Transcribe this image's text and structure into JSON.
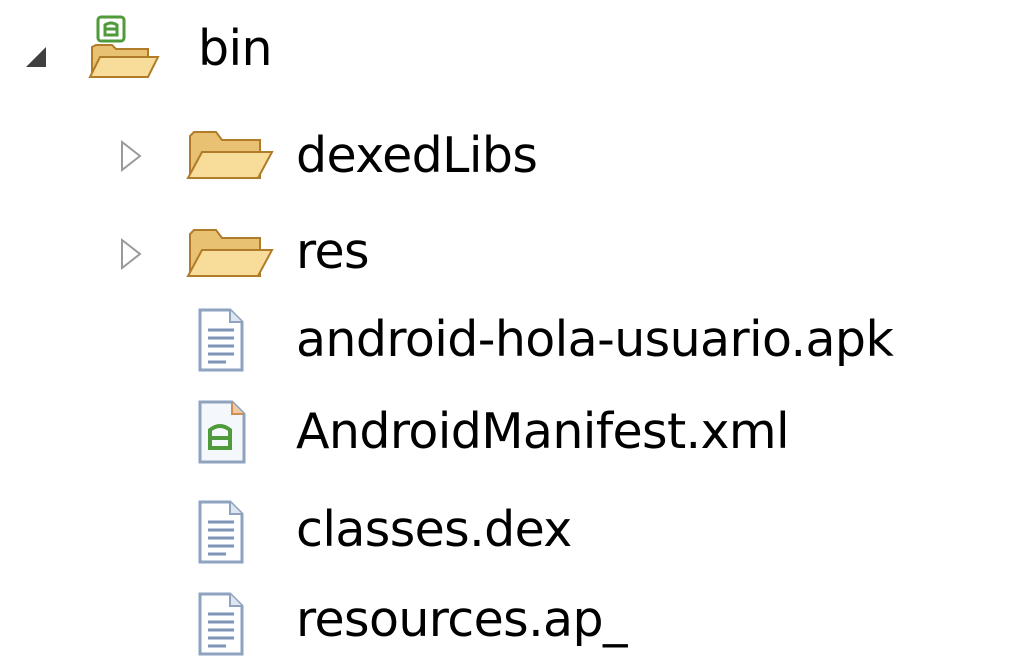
{
  "tree": {
    "root": {
      "label": "bin",
      "expanded": true,
      "icon": "android-output-folder-icon",
      "children": [
        {
          "label": "dexedLibs",
          "type": "folder",
          "expanded": false,
          "icon": "folder-icon"
        },
        {
          "label": "res",
          "type": "folder",
          "expanded": false,
          "icon": "folder-icon"
        },
        {
          "label": "android-hola-usuario.apk",
          "type": "file",
          "icon": "text-file-icon"
        },
        {
          "label": "AndroidManifest.xml",
          "type": "file",
          "icon": "android-manifest-icon"
        },
        {
          "label": "classes.dex",
          "type": "file",
          "icon": "text-file-icon"
        },
        {
          "label": "resources.ap_",
          "type": "file",
          "icon": "text-file-icon"
        }
      ]
    }
  },
  "colors": {
    "folder_fill": "#f3d28a",
    "folder_stroke": "#b07c2a",
    "android_green": "#4f9a3a",
    "file_fill": "#ffffff",
    "file_stroke": "#8ea3bf",
    "file_lines": "#7d94b8"
  }
}
